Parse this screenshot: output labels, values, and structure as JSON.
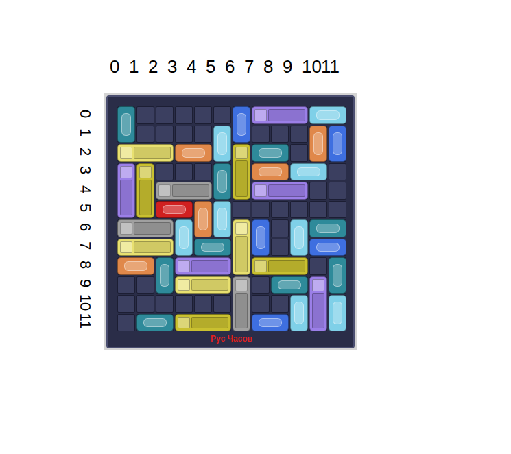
{
  "column_labels": [
    "0",
    "1",
    "2",
    "3",
    "4",
    "5",
    "6",
    "7",
    "8",
    "9",
    "10",
    "11"
  ],
  "row_labels": [
    "0",
    "1",
    "2",
    "3",
    "4",
    "5",
    "6",
    "7",
    "8",
    "9",
    "10",
    "11"
  ],
  "board": {
    "footer": "Рус Часов",
    "vehicles": [
      {
        "row": 0,
        "col": 0,
        "length": 2,
        "orientation": "v",
        "kind": "car",
        "color": "#2e8a9a"
      },
      {
        "row": 0,
        "col": 6,
        "length": 2,
        "orientation": "v",
        "kind": "car",
        "color": "#3e6fe0"
      },
      {
        "row": 0,
        "col": 7,
        "length": 3,
        "orientation": "h",
        "kind": "truck",
        "color": "#9b7fe8"
      },
      {
        "row": 0,
        "col": 10,
        "length": 2,
        "orientation": "h",
        "kind": "car",
        "color": "#7fd0e8"
      },
      {
        "row": 1,
        "col": 5,
        "length": 2,
        "orientation": "v",
        "kind": "car",
        "color": "#7fd0e8"
      },
      {
        "row": 1,
        "col": 10,
        "length": 2,
        "orientation": "v",
        "kind": "car",
        "color": "#e0884a"
      },
      {
        "row": 1,
        "col": 11,
        "length": 2,
        "orientation": "v",
        "kind": "car",
        "color": "#3e6fe0"
      },
      {
        "row": 2,
        "col": 0,
        "length": 3,
        "orientation": "h",
        "kind": "truck",
        "color": "#e8e070"
      },
      {
        "row": 2,
        "col": 3,
        "length": 2,
        "orientation": "h",
        "kind": "car",
        "color": "#e0884a"
      },
      {
        "row": 2,
        "col": 6,
        "length": 3,
        "orientation": "v",
        "kind": "truck",
        "color": "#c9c030"
      },
      {
        "row": 2,
        "col": 7,
        "length": 2,
        "orientation": "h",
        "kind": "car",
        "color": "#2e8a9a"
      },
      {
        "row": 3,
        "col": 0,
        "length": 3,
        "orientation": "v",
        "kind": "truck",
        "color": "#9b7fe8"
      },
      {
        "row": 3,
        "col": 1,
        "length": 3,
        "orientation": "v",
        "kind": "truck",
        "color": "#c9c030"
      },
      {
        "row": 3,
        "col": 5,
        "length": 2,
        "orientation": "v",
        "kind": "car",
        "color": "#2e8a9a"
      },
      {
        "row": 3,
        "col": 7,
        "length": 2,
        "orientation": "h",
        "kind": "car",
        "color": "#e0884a"
      },
      {
        "row": 3,
        "col": 9,
        "length": 2,
        "orientation": "h",
        "kind": "car",
        "color": "#7fd0e8"
      },
      {
        "row": 4,
        "col": 2,
        "length": 3,
        "orientation": "h",
        "kind": "truck",
        "color": "#a0a0a0"
      },
      {
        "row": 4,
        "col": 7,
        "length": 3,
        "orientation": "h",
        "kind": "truck",
        "color": "#9b7fe8"
      },
      {
        "row": 5,
        "col": 2,
        "length": 2,
        "orientation": "h",
        "kind": "car",
        "color": "#d02020"
      },
      {
        "row": 5,
        "col": 4,
        "length": 2,
        "orientation": "v",
        "kind": "car",
        "color": "#e0884a"
      },
      {
        "row": 5,
        "col": 5,
        "length": 2,
        "orientation": "v",
        "kind": "car",
        "color": "#7fd0e8"
      },
      {
        "row": 6,
        "col": 0,
        "length": 3,
        "orientation": "h",
        "kind": "truck",
        "color": "#a0a0a0"
      },
      {
        "row": 6,
        "col": 3,
        "length": 2,
        "orientation": "v",
        "kind": "car",
        "color": "#7fd0e8"
      },
      {
        "row": 6,
        "col": 6,
        "length": 3,
        "orientation": "v",
        "kind": "truck",
        "color": "#e8e070"
      },
      {
        "row": 6,
        "col": 7,
        "length": 2,
        "orientation": "v",
        "kind": "car",
        "color": "#3e6fe0"
      },
      {
        "row": 6,
        "col": 9,
        "length": 2,
        "orientation": "v",
        "kind": "car",
        "color": "#7fd0e8"
      },
      {
        "row": 6,
        "col": 10,
        "length": 2,
        "orientation": "h",
        "kind": "car",
        "color": "#2e8a9a"
      },
      {
        "row": 7,
        "col": 0,
        "length": 3,
        "orientation": "h",
        "kind": "truck",
        "color": "#e8e070"
      },
      {
        "row": 7,
        "col": 4,
        "length": 2,
        "orientation": "h",
        "kind": "car",
        "color": "#2e8a9a"
      },
      {
        "row": 7,
        "col": 10,
        "length": 2,
        "orientation": "h",
        "kind": "car",
        "color": "#3e6fe0"
      },
      {
        "row": 8,
        "col": 0,
        "length": 2,
        "orientation": "h",
        "kind": "car",
        "color": "#e0884a"
      },
      {
        "row": 8,
        "col": 2,
        "length": 2,
        "orientation": "v",
        "kind": "car",
        "color": "#2e8a9a"
      },
      {
        "row": 8,
        "col": 3,
        "length": 3,
        "orientation": "h",
        "kind": "truck",
        "color": "#9b7fe8"
      },
      {
        "row": 8,
        "col": 7,
        "length": 3,
        "orientation": "h",
        "kind": "truck",
        "color": "#c9c030"
      },
      {
        "row": 8,
        "col": 11,
        "length": 2,
        "orientation": "v",
        "kind": "car",
        "color": "#2e8a9a"
      },
      {
        "row": 9,
        "col": 3,
        "length": 3,
        "orientation": "h",
        "kind": "truck",
        "color": "#e8e070"
      },
      {
        "row": 9,
        "col": 6,
        "length": 3,
        "orientation": "v",
        "kind": "truck",
        "color": "#a0a0a0"
      },
      {
        "row": 9,
        "col": 8,
        "length": 2,
        "orientation": "h",
        "kind": "car",
        "color": "#2e8a9a"
      },
      {
        "row": 9,
        "col": 10,
        "length": 3,
        "orientation": "v",
        "kind": "truck",
        "color": "#9b7fe8"
      },
      {
        "row": 10,
        "col": 9,
        "length": 2,
        "orientation": "v",
        "kind": "car",
        "color": "#7fd0e8"
      },
      {
        "row": 10,
        "col": 11,
        "length": 2,
        "orientation": "v",
        "kind": "car",
        "color": "#7fd0e8"
      },
      {
        "row": 11,
        "col": 1,
        "length": 2,
        "orientation": "h",
        "kind": "car",
        "color": "#2e8a9a"
      },
      {
        "row": 11,
        "col": 3,
        "length": 3,
        "orientation": "h",
        "kind": "truck",
        "color": "#c9c030"
      },
      {
        "row": 11,
        "col": 7,
        "length": 2,
        "orientation": "h",
        "kind": "car",
        "color": "#3e6fe0"
      }
    ]
  }
}
